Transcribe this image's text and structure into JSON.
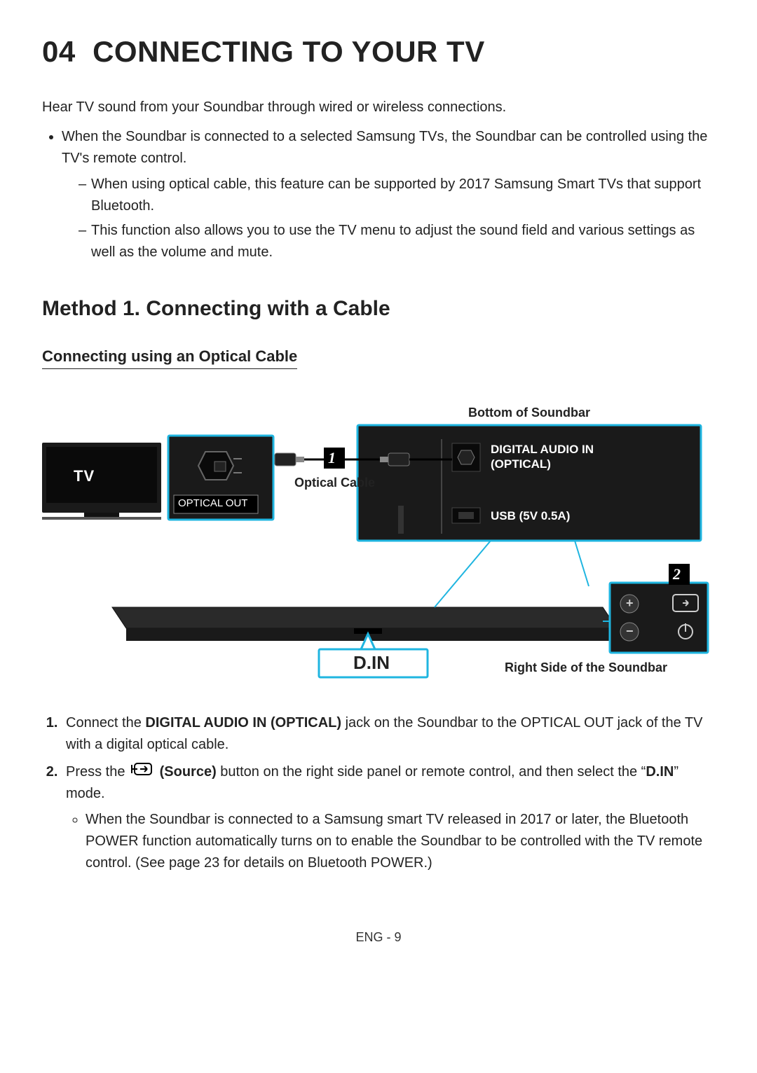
{
  "section_number": "04",
  "section_title": "CONNECTING TO YOUR TV",
  "intro": "Hear TV sound from your Soundbar through wired or wireless connections.",
  "bullet_main": "When the Soundbar is connected to a selected Samsung TVs, the Soundbar can be controlled using the TV's remote control.",
  "dash1": "When using optical cable, this feature can be supported by 2017 Samsung Smart TVs that support Bluetooth.",
  "dash2": "This function also allows you to use the TV menu to adjust the sound field and various settings as well as the volume and mute.",
  "method_title": "Method 1. Connecting with a Cable",
  "sub_title": "Connecting using an Optical Cable",
  "diagram": {
    "bottom_label": "Bottom of Soundbar",
    "tv_label": "TV",
    "optical_out": "OPTICAL OUT",
    "optical_cable": "Optical Cable",
    "digital_audio_in": "DIGITAL AUDIO IN (OPTICAL)",
    "usb": "USB (5V 0.5A)",
    "din": "D.IN",
    "right_side": "Right Side of the Soundbar",
    "callout1": "1",
    "callout2": "2",
    "plus": "+",
    "minus": "−"
  },
  "steps": {
    "s1_pre": "Connect the ",
    "s1_bold": "DIGITAL AUDIO IN (OPTICAL)",
    "s1_post": " jack on the Soundbar to the OPTICAL OUT jack of the TV with a digital optical cable.",
    "s2_pre": "Press the ",
    "s2_source": "(Source)",
    "s2_mid": " button on the right side panel or remote control, and then select the “",
    "s2_din": "D.IN",
    "s2_post": "” mode.",
    "sub_bullet": "When the Soundbar is connected to a Samsung smart TV released in 2017 or later, the Bluetooth POWER function automatically turns on to enable the Soundbar to be controlled with the TV remote control. (See page 23 for details on Bluetooth POWER.)"
  },
  "footer": "ENG - 9"
}
